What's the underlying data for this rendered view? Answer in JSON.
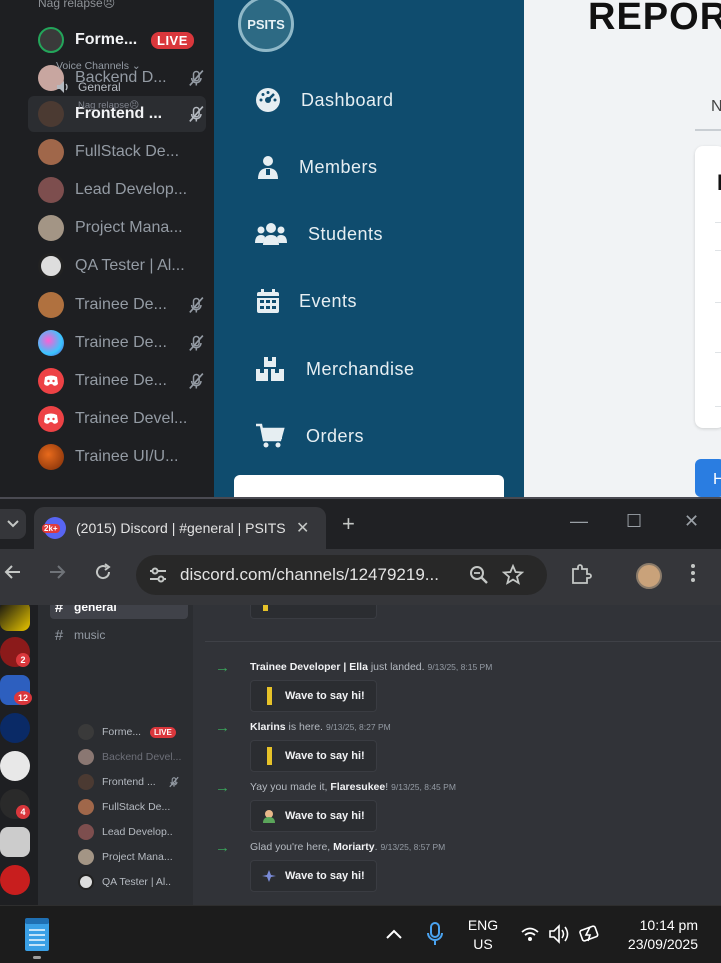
{
  "shared_screen": {
    "discord_voice": {
      "nag_label": "Nag relapse😣",
      "users": [
        {
          "name": "Forme...",
          "live": "LIVE",
          "bold": true
        },
        {
          "name": "Backend D...",
          "muted": true
        },
        {
          "name": "Frontend ...",
          "muted": true,
          "bold": true,
          "active": true
        },
        {
          "name": "FullStack De..."
        },
        {
          "name": "Lead Develop..."
        },
        {
          "name": "Project Mana..."
        },
        {
          "name": "QA Tester | Al..."
        },
        {
          "name": "Trainee De...",
          "muted": true
        },
        {
          "name": "Trainee De...",
          "muted": true
        },
        {
          "name": "Trainee De...",
          "muted": true
        },
        {
          "name": "Trainee Devel..."
        },
        {
          "name": "Trainee UI/U..."
        }
      ]
    },
    "psits": {
      "logo_text": "PSITS",
      "nav": [
        {
          "label": "Dashboard",
          "icon": "dashboard-icon"
        },
        {
          "label": "Members",
          "icon": "members-icon"
        },
        {
          "label": "Students",
          "icon": "students-icon"
        },
        {
          "label": "Events",
          "icon": "calendar-icon"
        },
        {
          "label": "Merchandise",
          "icon": "merchandise-icon"
        },
        {
          "label": "Orders",
          "icon": "cart-icon"
        }
      ]
    },
    "report": {
      "title": "REPOR",
      "tab_partial": "N",
      "card_heading_partial": "I",
      "button_partial": "H"
    }
  },
  "browser": {
    "tab_badge": "2k+",
    "tab_title": "(2015) Discord | #general | PSITS",
    "url": "discord.com/channels/12479219...",
    "colors": {
      "accent": "#5865f2"
    }
  },
  "discord": {
    "servers": [
      {
        "badge": ""
      },
      {
        "badge": "2"
      },
      {
        "badge": "12"
      },
      {
        "badge": ""
      },
      {
        "badge": ""
      },
      {
        "badge": "4"
      },
      {
        "badge": ""
      },
      {
        "badge": ""
      }
    ],
    "text_channels": [
      {
        "name": "general",
        "selected": true
      },
      {
        "name": "music"
      }
    ],
    "voice_header": "Voice Channels ⌄",
    "voice_channel": "General",
    "nag_label": "Nag relapse😣",
    "voice_members": [
      {
        "name": "Forme...",
        "live": "LIVE"
      },
      {
        "name": "Backend Devel...",
        "dim": true
      },
      {
        "name": "Frontend ...",
        "muted": true
      },
      {
        "name": "FullStack De..."
      },
      {
        "name": "Lead Develop..."
      },
      {
        "name": "Project Mana..."
      },
      {
        "name": "QA Tester | Al..."
      }
    ],
    "messages": [
      {
        "pre": "",
        "user": "Trainee Developer | Ella",
        "post": " just landed.",
        "ts": "9/13/25, 8:15 PM",
        "button": "Wave to say hi!"
      },
      {
        "pre": "",
        "user": "Klarins",
        "post": " is here.",
        "ts": "9/13/25, 8:27 PM",
        "button": "Wave to say hi!"
      },
      {
        "pre": "Yay you made it, ",
        "user": "Flaresukee",
        "post": "!",
        "ts": "9/13/25, 8:45 PM",
        "button": "Wave to say hi!"
      },
      {
        "pre": "Glad you're here, ",
        "user": "Moriarty",
        "post": ".",
        "ts": "9/13/25, 8:57 PM",
        "button": "Wave to say hi!"
      }
    ]
  },
  "taskbar": {
    "lang_line1": "ENG",
    "lang_line2": "US",
    "time": "10:14 pm",
    "date": "23/09/2025"
  }
}
